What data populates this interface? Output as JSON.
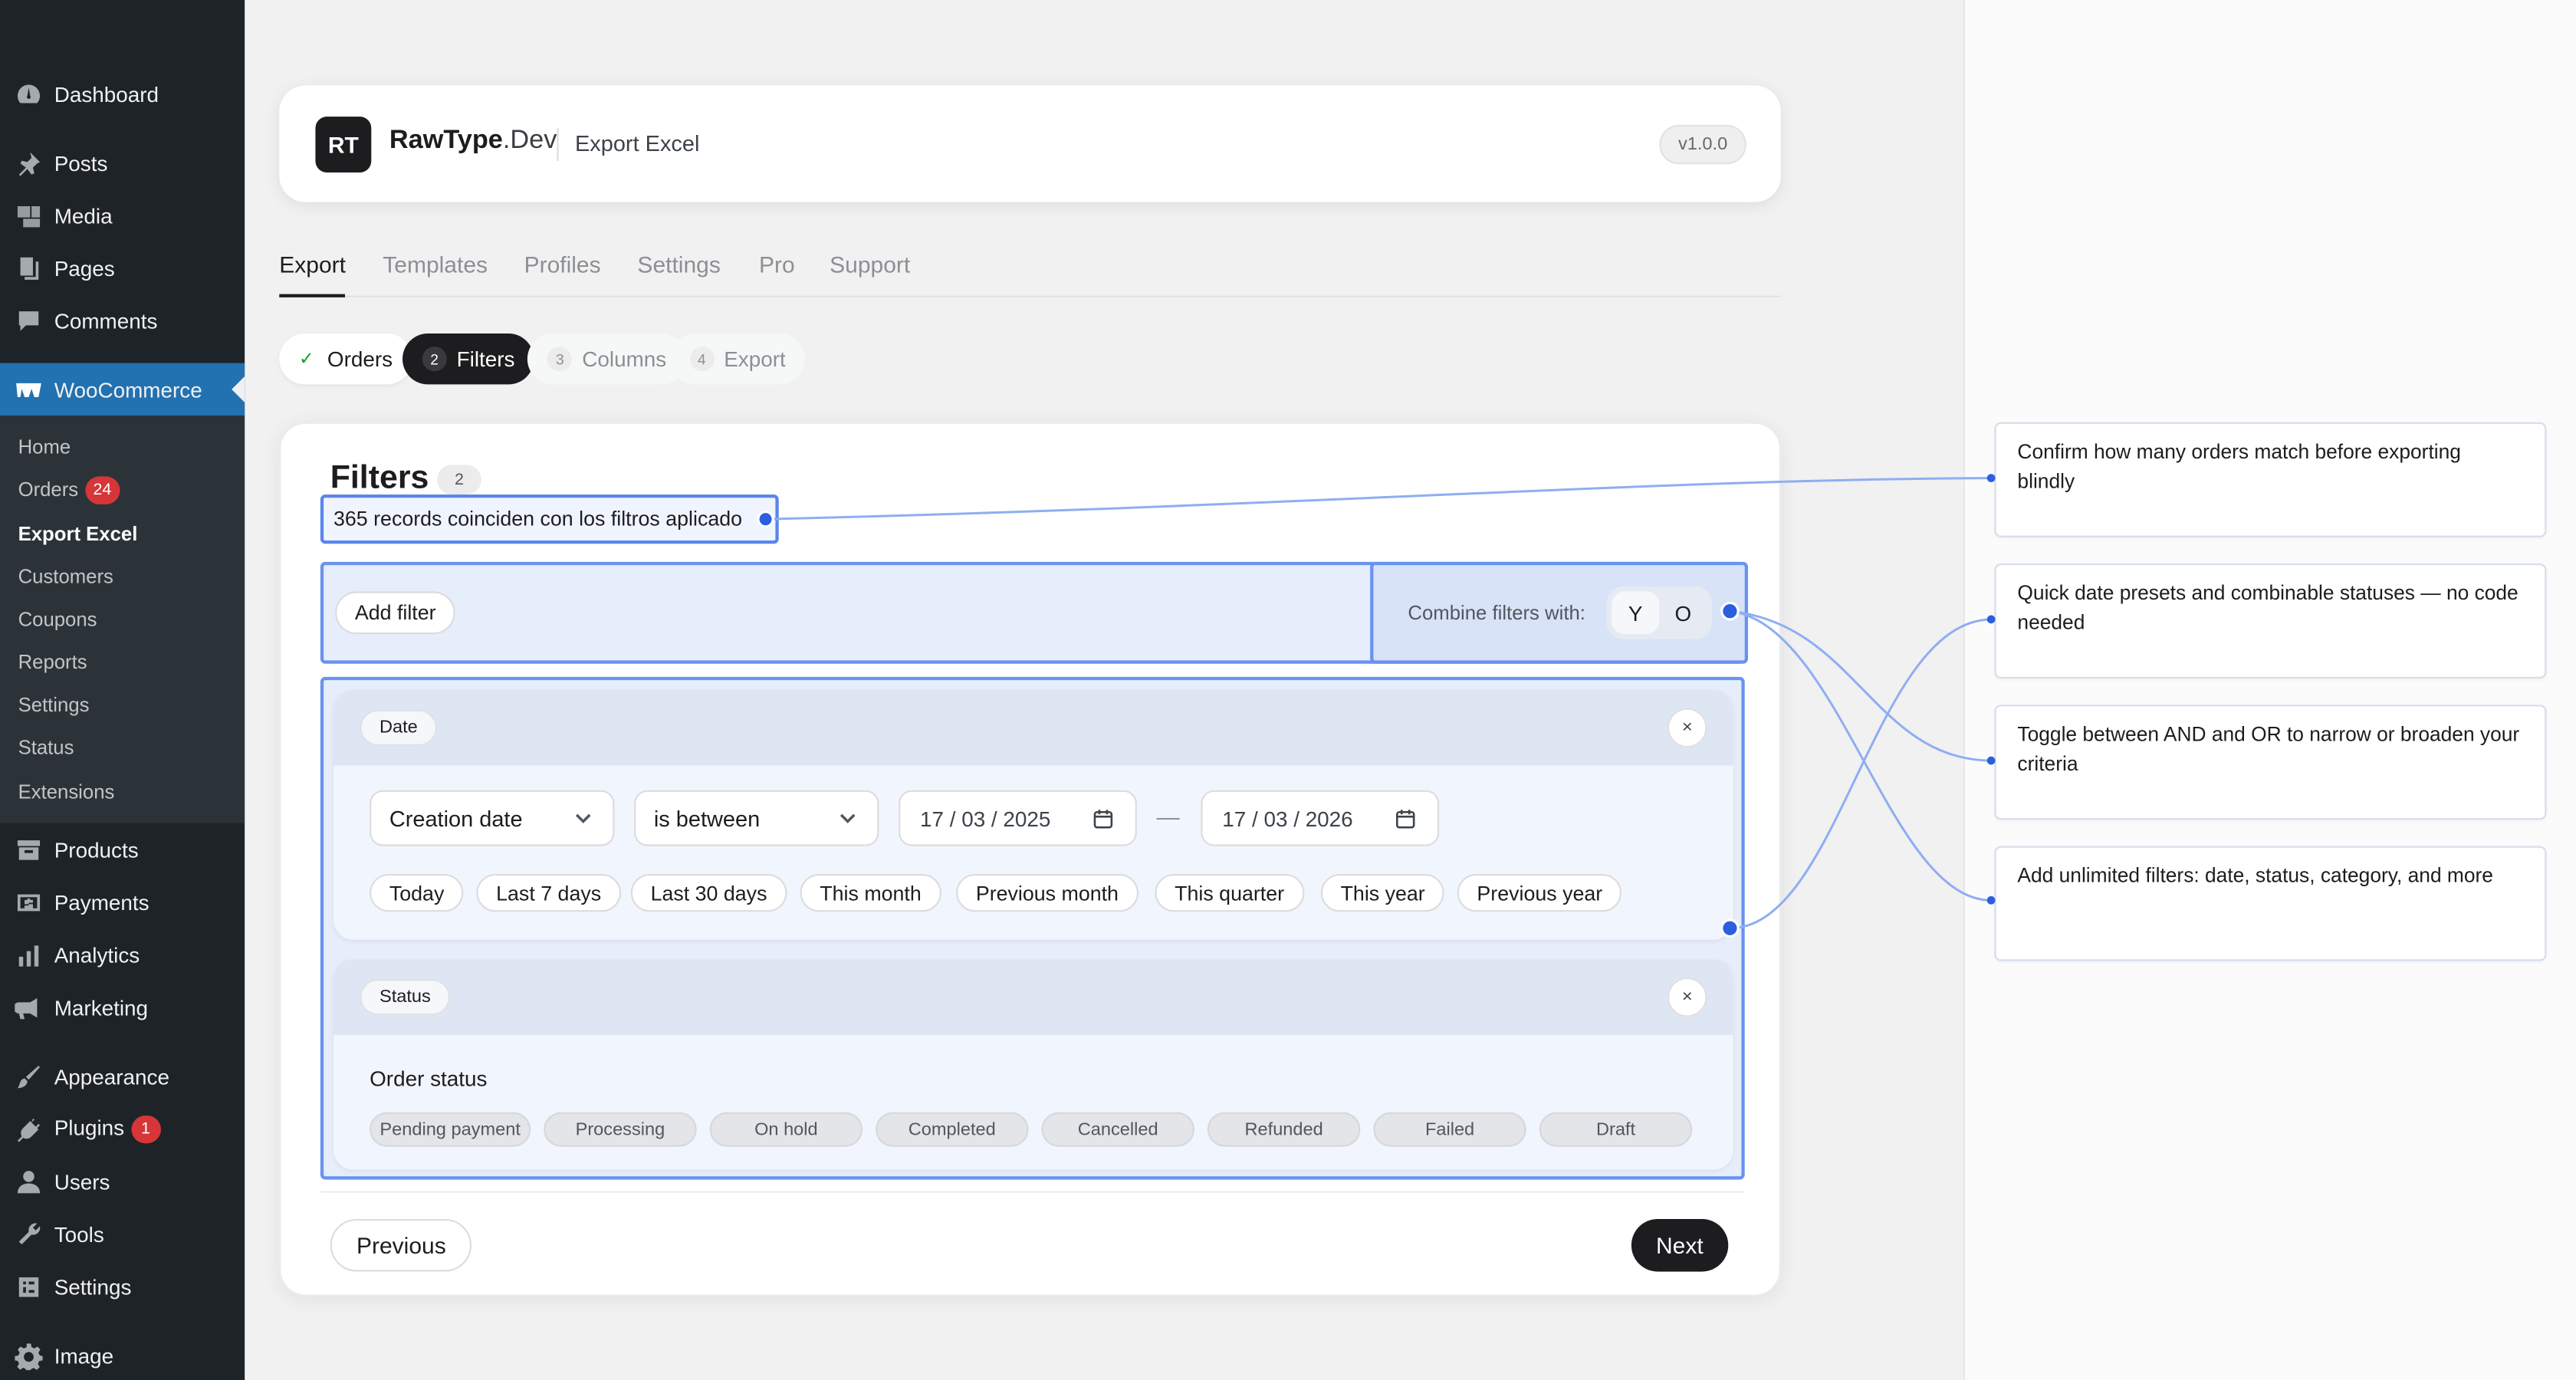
{
  "sidebar": {
    "dashboard": "Dashboard",
    "posts": "Posts",
    "media": "Media",
    "pages": "Pages",
    "comments": "Comments",
    "woocommerce": "WooCommerce",
    "sub": {
      "home": "Home",
      "orders": "Orders",
      "orders_count": "24",
      "export_excel": "Export Excel",
      "customers": "Customers",
      "coupons": "Coupons",
      "reports": "Reports",
      "settings": "Settings",
      "status": "Status",
      "extensions": "Extensions"
    },
    "products": "Products",
    "payments": "Payments",
    "analytics": "Analytics",
    "marketing": "Marketing",
    "appearance": "Appearance",
    "plugins": "Plugins",
    "plugins_count": "1",
    "users": "Users",
    "tools": "Tools",
    "settings": "Settings",
    "image": "Image"
  },
  "header": {
    "logo": "RT",
    "brand_bold": "RawType",
    "brand_light": ".Dev",
    "subtitle": "Export Excel",
    "version": "v1.0.0"
  },
  "tabs": [
    "Export",
    "Templates",
    "Profiles",
    "Settings",
    "Pro",
    "Support"
  ],
  "steps": {
    "s1": {
      "label": "Orders",
      "check": "✓"
    },
    "s2": {
      "num": "2",
      "label": "Filters"
    },
    "s3": {
      "num": "3",
      "label": "Columns"
    },
    "s4": {
      "num": "4",
      "label": "Export"
    }
  },
  "filters": {
    "title": "Filters",
    "count": "2",
    "records": "365 records coinciden con los filtros aplicado",
    "add_filter": "Add filter",
    "combine_label": "Combine filters with:",
    "combine_options": [
      "Y",
      "O"
    ]
  },
  "date_group": {
    "tag": "Date",
    "close": "×",
    "field": "Creation date",
    "operator": "is between",
    "from": "17 / 03 / 2025",
    "dash": "—",
    "to": "17 / 03 / 2026",
    "presets": [
      "Today",
      "Last 7 days",
      "Last 30 days",
      "This month",
      "Previous month",
      "This quarter",
      "This year",
      "Previous year"
    ]
  },
  "status_group": {
    "tag": "Status",
    "close": "×",
    "label": "Order status",
    "chips": [
      "Pending payment",
      "Processing",
      "On hold",
      "Completed",
      "Cancelled",
      "Refunded",
      "Failed",
      "Draft"
    ]
  },
  "nav": {
    "previous": "Previous",
    "next": "Next"
  },
  "notes": [
    "Confirm how many orders match before exporting blindly",
    "Quick date presets and combinable statuses — no code needed",
    "Toggle between AND and OR to narrow or broaden your criteria",
    "Add unlimited filters: date, status, category, and more"
  ],
  "colors": {
    "wp_sidebar": "#1d2327",
    "wp_active": "#2271b1",
    "badge": "#d63638",
    "highlight_border": "#6a93ef",
    "highlight_fill": "#e6edfb",
    "connector": "#7fa3f0",
    "connector_dot": "#2b5fe0"
  }
}
